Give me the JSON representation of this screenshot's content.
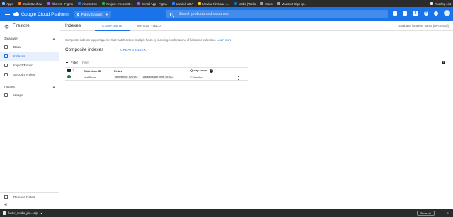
{
  "bookmarks": {
    "items": [
      {
        "label": "Apps",
        "color": "#8ab4f8"
      },
      {
        "label": "Stack Overflow",
        "color": "#f48024"
      },
      {
        "label": "Tiko V.2 - Figma",
        "color": "#a259ff"
      },
      {
        "label": "AccessOne",
        "color": "#1a73e8"
      },
      {
        "label": "Project : AccessO...",
        "color": "#34a853"
      },
      {
        "label": "Dental App - Figma",
        "color": "#a259ff"
      },
      {
        "label": "Unwind JIRA",
        "color": "#2684ff"
      },
      {
        "label": "Unwind Firebase c...",
        "color": "#ffca28"
      },
      {
        "label": "Modo | Trello",
        "color": "#0079bf"
      },
      {
        "label": "Modo",
        "color": "#9aa0a6"
      },
      {
        "label": "Modo LZ Sign up...",
        "color": "#9aa0a6"
      }
    ],
    "right": "Reading List"
  },
  "topbar": {
    "app_title": "Google Cloud Platform",
    "project": "Planty Connect",
    "search_placeholder": "Search products and resources",
    "notification_count": "3"
  },
  "sidebar": {
    "product": "Firestore",
    "sections": [
      {
        "title": "Database",
        "items": [
          {
            "label": "Data",
            "icon": "data-icon",
            "active": false
          },
          {
            "label": "Indexes",
            "icon": "indexes-icon",
            "active": true
          },
          {
            "label": "Import/Export",
            "icon": "import-export-icon",
            "active": false
          },
          {
            "label": "Security Rules",
            "icon": "security-rules-icon",
            "active": false
          }
        ]
      },
      {
        "title": "Insights",
        "items": [
          {
            "label": "Usage",
            "icon": "usage-icon",
            "active": false
          }
        ]
      }
    ],
    "release_notes": "Release Notes"
  },
  "main": {
    "title": "Indexes",
    "tabs": [
      {
        "label": "COMPOSITE",
        "active": true
      },
      {
        "label": "SINGLE FIELD",
        "active": false
      }
    ],
    "db_location": "Database location: nam5 (us-central)",
    "description": "Composite indexes support queries that match across multiple fields by indexing combinations of fields in a collection.",
    "learn_more": "Learn more",
    "section_title": "Composite indexes",
    "create_label": "CREATE INDEX",
    "filter_label": "Filter",
    "filter_placeholder": "Filter",
    "columns": [
      "Collection ID",
      "Fields",
      "Query scope"
    ],
    "rows": [
      {
        "collection_id": "chatRoom",
        "fields": [
          "memberId: ARRAY",
          "lastMessageTime: DESC"
        ],
        "query_scope": "Collection"
      }
    ]
  },
  "downloads": {
    "file": "flutter_media_pic....zip",
    "show_all": "Show all"
  },
  "colors": {
    "accent": "#1a73e8",
    "active_bg": "#e8f0fe",
    "success": "#188038"
  }
}
